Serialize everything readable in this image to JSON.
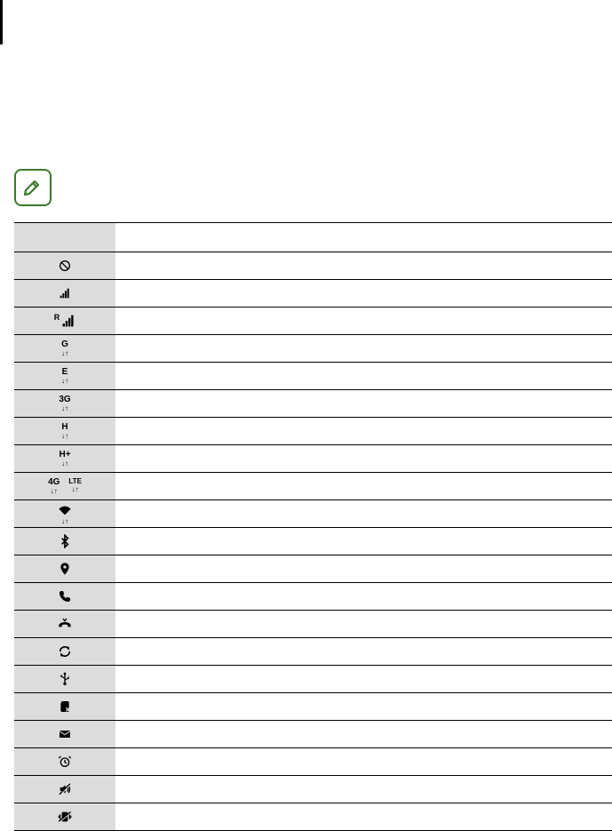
{
  "icons": {
    "note": "edit-note",
    "rows": [
      {
        "id": "no-signal",
        "label": "no-signal-icon",
        "type": "svg-nosignal",
        "desc": ""
      },
      {
        "id": "signal",
        "label": "signal-strength-icon",
        "type": "svg-signal",
        "desc": ""
      },
      {
        "id": "roaming",
        "label": "roaming-icon",
        "type": "signal-r",
        "text": "R",
        "desc": ""
      },
      {
        "id": "gprs",
        "label": "gprs-network-icon",
        "type": "net",
        "text": "G",
        "desc": ""
      },
      {
        "id": "edge",
        "label": "edge-network-icon",
        "type": "net",
        "text": "E",
        "desc": ""
      },
      {
        "id": "3g",
        "label": "3g-network-icon",
        "type": "net",
        "text": "3G",
        "desc": ""
      },
      {
        "id": "hspa",
        "label": "hspa-network-icon",
        "type": "net",
        "text": "H",
        "desc": ""
      },
      {
        "id": "hspa-plus",
        "label": "hspa-plus-network-icon",
        "type": "net",
        "text": "H+",
        "desc": ""
      },
      {
        "id": "4g-lte",
        "label": "4g-lte-network-icon",
        "type": "net-dual",
        "text1": "4G",
        "text2": "LTE",
        "desc": ""
      },
      {
        "id": "wifi",
        "label": "wifi-icon",
        "type": "svg-wifi",
        "desc": ""
      },
      {
        "id": "bluetooth",
        "label": "bluetooth-icon",
        "type": "svg-bt",
        "desc": ""
      },
      {
        "id": "gps",
        "label": "gps-location-icon",
        "type": "svg-gps",
        "desc": ""
      },
      {
        "id": "call",
        "label": "call-in-progress-icon",
        "type": "svg-call",
        "desc": ""
      },
      {
        "id": "missed-call",
        "label": "missed-call-icon",
        "type": "svg-missed",
        "desc": ""
      },
      {
        "id": "sync",
        "label": "sync-icon",
        "type": "svg-sync",
        "desc": ""
      },
      {
        "id": "usb",
        "label": "usb-connected-icon",
        "type": "svg-usb",
        "desc": ""
      },
      {
        "id": "no-sim",
        "label": "no-sim-icon",
        "type": "svg-nosim",
        "desc": ""
      },
      {
        "id": "message",
        "label": "new-message-icon",
        "type": "svg-msg",
        "desc": ""
      },
      {
        "id": "alarm",
        "label": "alarm-icon",
        "type": "svg-alarm",
        "desc": ""
      },
      {
        "id": "mute",
        "label": "mute-icon",
        "type": "svg-mute",
        "desc": ""
      },
      {
        "id": "vibrate",
        "label": "vibrate-icon",
        "type": "svg-vibrate",
        "desc": ""
      }
    ],
    "header": {
      "icon_col": "",
      "desc_col": ""
    }
  }
}
